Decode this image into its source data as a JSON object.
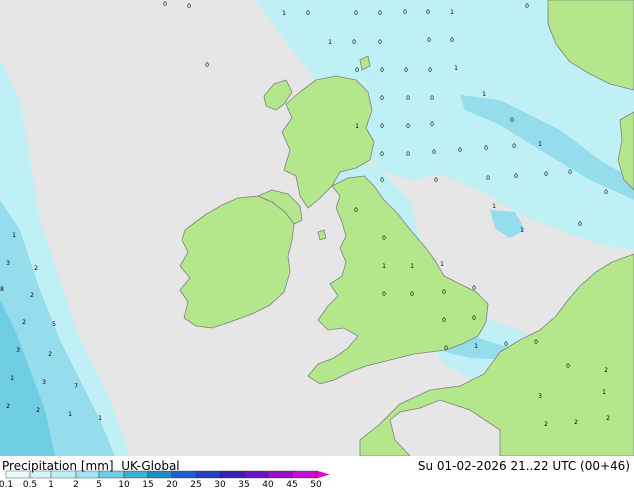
{
  "title": {
    "product": "Precipitation [mm]",
    "model": "UK-Global",
    "valid_time": "Su 01-02-2026 21..22 UTC (00+46)"
  },
  "colors": {
    "sea": "#e6e6e6",
    "land": "#b4e68c",
    "coast": "#808080",
    "precip_light": "#bff0f5",
    "precip_medium": "#95dcec"
  },
  "legend": {
    "ticks": [
      "0.1",
      "0.5",
      "1",
      "2",
      "5",
      "10",
      "15",
      "20",
      "25",
      "30",
      "35",
      "40",
      "45",
      "50"
    ],
    "colors": [
      "#eaf9fb",
      "#d7f4f8",
      "#bff0f5",
      "#a3e6f0",
      "#6fcde2",
      "#3db0d0",
      "#1a8ec2",
      "#1e5fd0",
      "#2a3ec8",
      "#3b1fb8",
      "#6a12c8",
      "#9a0ed0",
      "#c80cd0",
      "#e20ac4"
    ]
  },
  "map_labels": [
    {
      "v": "0"
    },
    {
      "v": "0"
    },
    {
      "v": "1"
    },
    {
      "v": "0"
    },
    {
      "v": "0"
    },
    {
      "v": "0"
    },
    {
      "v": "0"
    },
    {
      "v": "0"
    },
    {
      "v": "1"
    },
    {
      "v": "0"
    },
    {
      "v": "1"
    },
    {
      "v": "0"
    },
    {
      "v": "0"
    },
    {
      "v": "0"
    },
    {
      "v": "0"
    },
    {
      "v": "0"
    },
    {
      "v": "0"
    },
    {
      "v": "0"
    },
    {
      "v": "0"
    },
    {
      "v": "0"
    },
    {
      "v": "1"
    },
    {
      "v": "0"
    },
    {
      "v": "0"
    },
    {
      "v": "0"
    },
    {
      "v": "1"
    },
    {
      "v": "1"
    },
    {
      "v": "0"
    },
    {
      "v": "0"
    },
    {
      "v": "0"
    },
    {
      "v": "0"
    },
    {
      "v": "0"
    },
    {
      "v": "0"
    },
    {
      "v": "0"
    },
    {
      "v": "0"
    },
    {
      "v": "0"
    },
    {
      "v": "0"
    },
    {
      "v": "1"
    },
    {
      "v": "0"
    },
    {
      "v": "0"
    },
    {
      "v": "0"
    },
    {
      "v": "0"
    },
    {
      "v": "0"
    },
    {
      "v": "0"
    },
    {
      "v": "0"
    },
    {
      "v": "0"
    },
    {
      "v": "1"
    },
    {
      "v": "1"
    },
    {
      "v": "0"
    },
    {
      "v": "0"
    },
    {
      "v": "1"
    },
    {
      "v": "1"
    },
    {
      "v": "1"
    },
    {
      "v": "0"
    },
    {
      "v": "0"
    },
    {
      "v": "0"
    },
    {
      "v": "0"
    },
    {
      "v": "0"
    },
    {
      "v": "0"
    },
    {
      "v": "0"
    },
    {
      "v": "1"
    },
    {
      "v": "0"
    },
    {
      "v": "0"
    },
    {
      "v": "0"
    },
    {
      "v": "2"
    },
    {
      "v": "3"
    },
    {
      "v": "1"
    },
    {
      "v": "2"
    },
    {
      "v": "2"
    },
    {
      "v": "2"
    },
    {
      "v": "1"
    },
    {
      "v": "3"
    },
    {
      "v": "2"
    },
    {
      "v": "8"
    },
    {
      "v": "2"
    },
    {
      "v": "2"
    },
    {
      "v": "5"
    },
    {
      "v": "3"
    },
    {
      "v": "2"
    },
    {
      "v": "1"
    },
    {
      "v": "3"
    },
    {
      "v": "7"
    },
    {
      "v": "2"
    },
    {
      "v": "2"
    },
    {
      "v": "1"
    },
    {
      "v": "1"
    }
  ]
}
